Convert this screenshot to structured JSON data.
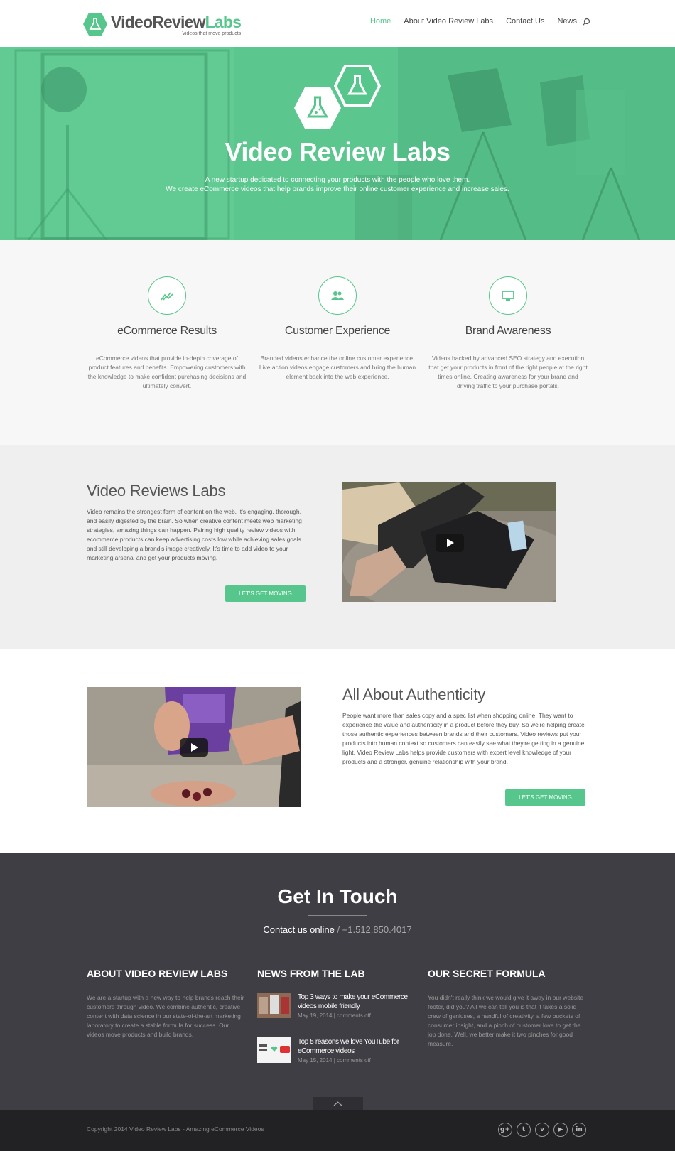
{
  "brand": {
    "name_part1": "VideoReview",
    "name_part2": "Labs",
    "tagline": "Videos that move products",
    "accent_color": "#56c68c"
  },
  "nav": {
    "items": [
      {
        "label": "Home",
        "active": true
      },
      {
        "label": "About Video Review Labs",
        "active": false
      },
      {
        "label": "Contact Us",
        "active": false
      },
      {
        "label": "News",
        "active": false
      }
    ],
    "search_icon": "search-icon"
  },
  "hero": {
    "title": "Video Review Labs",
    "subtitle_line1": "A new startup dedicated to connecting your products with the people who love them.",
    "subtitle_line2": "We create eCommerce videos that help brands improve their online customer experience and increase sales."
  },
  "features": [
    {
      "icon": "chart-trend-icon",
      "title": "eCommerce Results",
      "text": "eCommerce videos that provide in-depth coverage of product features and benefits. Empowering customers with the knowledge to make confident purchasing decisions and ultimately convert."
    },
    {
      "icon": "users-icon",
      "title": "Customer Experience",
      "text": "Branded videos enhance the online customer experience. Live action videos engage customers and bring the human element back into the web experience."
    },
    {
      "icon": "monitor-icon",
      "title": "Brand Awareness",
      "text": "Videos backed by advanced SEO strategy and execution that get your products in front of the right people at the right times online. Creating awareness for your brand and driving traffic to your purchase portals."
    }
  ],
  "section1": {
    "title": "Video Reviews Labs",
    "text": "Video remains the strongest form of content on the web. It's engaging, thorough, and easily digested by the brain. So when creative content meets web marketing strategies, amazing things can happen. Pairing high quality review videos with ecommerce products can keep advertising costs low while achieving sales goals and still developing a brand's image creatively. It's time to add video to your marketing arsenal and get your products moving.",
    "button": "LET'S GET MOVING"
  },
  "section2": {
    "title": "All About Authenticity",
    "text": "People want more than sales copy and a spec list when shopping online. They want to experience the value and authenticity in a product before they buy. So we're helping create those authentic experiences between brands and their customers. Video reviews put your products into human context so customers can easily see what they're getting in a genuine light. Video Review Labs helps provide customers with expert level knowledge of your products and a stronger, genuine relationship with your brand.",
    "button": "LET'S GET MOVING"
  },
  "footer": {
    "title": "Get In Touch",
    "contact_label": "Contact us online",
    "contact_phone": " / +1.512.850.4017",
    "about": {
      "title": "ABOUT VIDEO REVIEW LABS",
      "text": "We are a startup with a new way to help brands reach their customers through video. We combine authentic, creative content with data science in our state-of-the-art marketing laboratory to create a stable formula for success. Our videos move products and build brands."
    },
    "news": {
      "title": "NEWS FROM THE LAB",
      "items": [
        {
          "title": "Top 3 ways to make your eCommerce videos mobile friendly",
          "date": "May 19, 2014",
          "comments": "comments off"
        },
        {
          "title": "Top 5 reasons we love YouTube for eCommerce videos",
          "date": "May 15, 2014",
          "comments": "comments off"
        }
      ]
    },
    "formula": {
      "title": "OUR SECRET FORMULA",
      "text": "You didn't really think we would give it away in our website footer, did you? All we can tell you is that it takes a solid crew of geniuses, a handful of creativity, a few buckets of consumer insight, and a pinch of customer love to get the job done. Well, we better make it two pinches for good measure."
    }
  },
  "bottom": {
    "copyright": "Copyright 2014 Video Review Labs - Amazing eCommerce Videos",
    "socials": [
      {
        "icon": "google-plus-icon",
        "glyph": "g+"
      },
      {
        "icon": "twitter-icon",
        "glyph": "t"
      },
      {
        "icon": "vimeo-icon",
        "glyph": "v"
      },
      {
        "icon": "youtube-icon",
        "glyph": "▶"
      },
      {
        "icon": "linkedin-icon",
        "glyph": "in"
      }
    ]
  }
}
